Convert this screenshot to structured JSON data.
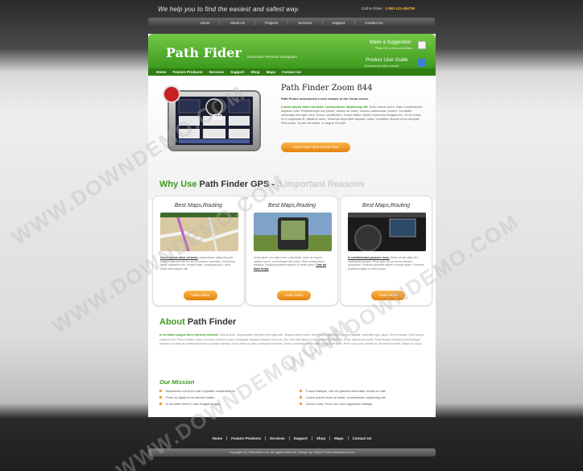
{
  "top": {
    "tagline": "We help you to find the easiest and safest way.",
    "call_label": "Call to Order :",
    "call_number": "1-800-123-456789"
  },
  "topnav": [
    "Home",
    "About Us",
    "Projects",
    "Services",
    "Support",
    "Contact Us"
  ],
  "header": {
    "logo": "Path Fider",
    "logo_sub": "Innovative Personal Navigation",
    "link1": "Make a Suggestion",
    "link1_sub": "Please let us know your ideas",
    "link2": "Product User Guide",
    "link2_sub": "Download the latest manual"
  },
  "mainnav": [
    "Home",
    "Feature Products",
    "Services",
    "Support",
    "Shop",
    "Maps",
    "Contact Us"
  ],
  "hero": {
    "title": "Path Finder Zoom 844",
    "subtitle": "Path Finder announced a new release in the Zoom series.",
    "lead": "Lorem ipsum dolor sit amet, consectetuer adipiscing elit.",
    "text": "Duis cursus tortor. Nam consectetuer dapibus odio. Pellentesque est ipsum, dictum sit amet, cursus malesuada, ornare. Curabitur venenatis est eget urna. Donec vestibulum. Fusce tellus. Morbi commodo feugiat orci. Ut vel tortor, id ut vulputate ut, dapibus nunc. Vivamus imperdiet aliquam nulla. Curabitur mauris urna volutpat. Sed purus. Donec faucibus. In augue id nulla.",
    "button": "Learn more about Zoom 844",
    "gps_number": "69"
  },
  "why": {
    "part1": "Why Use",
    "part2": "Path Finder GPS -",
    "part3": "3 Important Reasons"
  },
  "cards": [
    {
      "title": "Best Maps,Routing",
      "lead": "Lorem ipsum dolor sit amet,",
      "text": "consectetuer adipiscing elit. Nullam interdum dui in orci fermentum imperdiet. Sed ipsum ligula, dignissim non, feugiat vitae, consequat quis, dolor. Nulla nunc aliquet nisl.",
      "button": "Learn More"
    },
    {
      "title": "Best Maps,Routing",
      "lead": "Cras ad diam turpis",
      "text": "Ut tincidunt, est vitae lorem sollicitudin, diam ac mauris ultrices lorem, nunc feugiat nisl lorem. Nam consectetuer dapibus. Vivamus pharetra sapien ut amet quam.",
      "button": "Learn More"
    },
    {
      "title": "Best Maps,Routing",
      "lead": "In condimentum posuere risus.",
      "text": "Etiam at nisi vitae nisl malesuada tempor. Proin quis dui sed tortor semper accumsan. Vivamus pharetra sapien ut amet quam. Vivamus pharetra sapien ut amet quam.",
      "button": "Learn More"
    }
  ],
  "about": {
    "part1": "About",
    "part2": "Path Finder",
    "lead": "In vel tellus congue libero ultricies molestie.",
    "text": "Duis at diam. Suspendisse interdum velit eget ante. Vivamus tellus lorem, elementum vestibulum, tempor sagittis, venenatis eget, lacus. Sed ut massa. Duis tempor euismod orci. Proin ut lectus. Nunc vel dolor ut lorem cursus consequat. Aliquam tristique nunc nec nisi. Sed vitae ligula ut nisi vestibulum vehicula. In dui. Maecenas mollis. Pellentesque habitant morbi tristique senectus et netus et malesuada fames ac turpis egestas. Sed in dolor ut justo consequat hendrerit. Donec commodo velit a diam. Etiam eget tortor. Proin nunc urna, laoreet at, hendrerit sit amet, dictum ut, lacus."
  },
  "mission": {
    "title": "Our Mission",
    "left": [
      "Maecenas a erat eu erat vulputate condimentum.",
      "Proin ac ligula et mi laoreet mattis.",
      "In sit amet enim in odio feugiat feugiat."
    ],
    "right": [
      "Fusce tristique, nisl vel gravida venenatis, metus et erat.",
      "Lorem ipsum dolor sit amet, consectetuer adipiscing elit.",
      "Donec nulla. Proin nec urna dignissim tristique."
    ]
  },
  "footnav": [
    "Home",
    "Feature Products",
    "Services",
    "Support",
    "Shop",
    "Maps",
    "Contact Us"
  ],
  "footer": {
    "copyright": "Copyright (c) Sitename.com. All rights reserved. Design by Stylish From downdemo.com"
  },
  "watermark": "WWW.DOWNDEMO.COM",
  "colors": {
    "brand_green": "#3d9a1e",
    "accent_orange": "#e2830e",
    "dark_nav": "#2f7d13"
  }
}
